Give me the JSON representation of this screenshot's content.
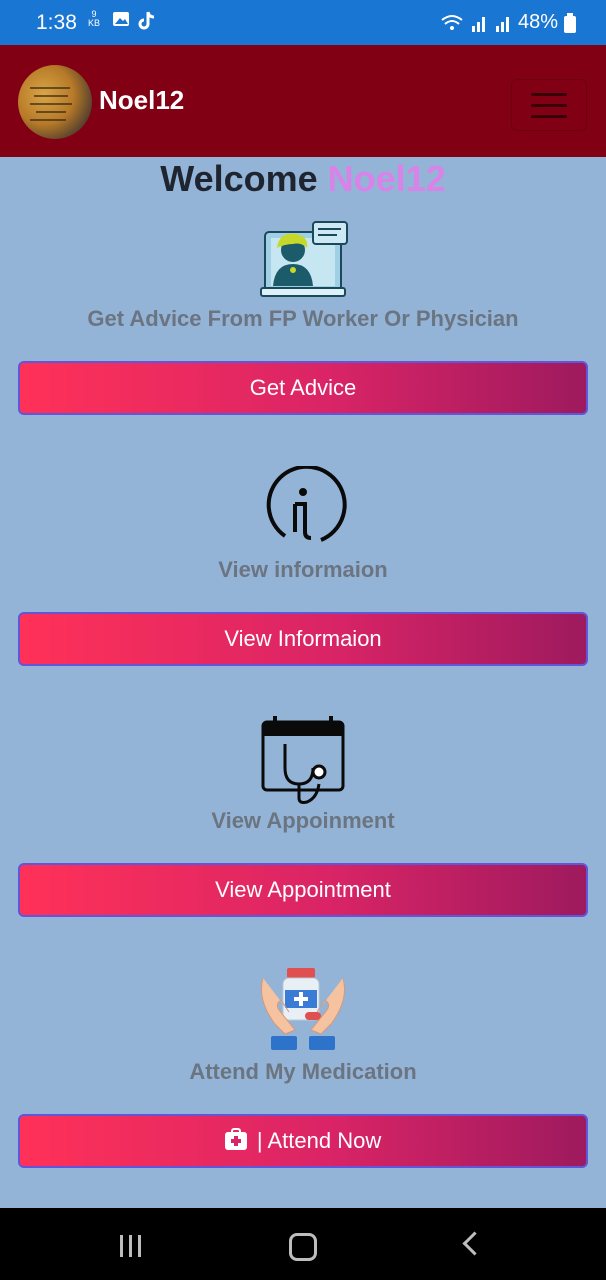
{
  "status_bar": {
    "time": "1:38",
    "kb_top": "9",
    "kb_bottom": "KB",
    "battery": "48%"
  },
  "header": {
    "brand": "Noel12"
  },
  "welcome": {
    "prefix": "Welcome",
    "username": "Noel12"
  },
  "sections": [
    {
      "label": "Get Advice From FP Worker Or Physician",
      "button": "Get Advice"
    },
    {
      "label": "View informaion",
      "button": "View Informaion"
    },
    {
      "label": "View Appoinment",
      "button": "View Appointment"
    },
    {
      "label": "Attend My Medication",
      "button": "| Attend Now"
    }
  ],
  "colors": {
    "status_bar": "#1976d2",
    "header": "#810014",
    "background": "#94b4d7",
    "button_gradient_start": "#ff3158",
    "button_gradient_end": "#9e1a5e",
    "username_accent": "#d982e8"
  },
  "icons": [
    "doctor-consult-icon",
    "info-icon",
    "calendar-stethoscope-icon",
    "medication-hands-icon",
    "first-aid-kit-icon"
  ]
}
